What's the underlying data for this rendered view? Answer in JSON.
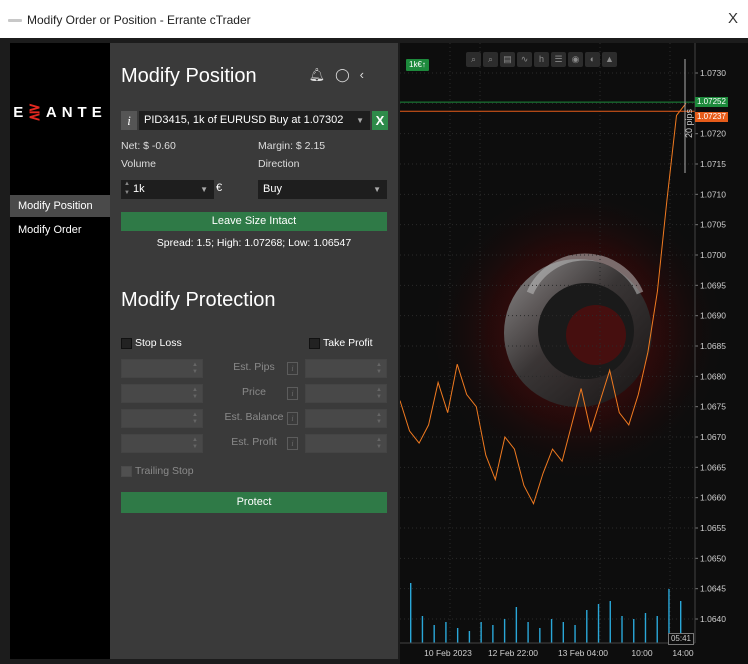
{
  "window": {
    "title": "Modify Order or Position - Errante cTrader",
    "close_glyph": "X"
  },
  "sidebar": {
    "logo_left": "E",
    "logo_right": "ANTE",
    "items": [
      {
        "label": "Modify Position",
        "active": true
      },
      {
        "label": "Modify Order",
        "active": false
      }
    ]
  },
  "modify_position": {
    "title": "Modify Position",
    "info_glyph": "i",
    "position_select": "PID3415, 1k of EURUSD Buy at 1.07302",
    "close_position_glyph": "X",
    "net": "Net: $ -0.60",
    "margin": "Margin: $ 2.15",
    "volume_label": "Volume",
    "direction_label": "Direction",
    "volume_value": "1k",
    "currency": "€",
    "direction_value": "Buy",
    "leave_size_button": "Leave Size Intact",
    "spread_line": "Spread: 1.5; High: 1.07268; Low: 1.06547"
  },
  "modify_protection": {
    "title": "Modify Protection",
    "stop_loss_label": "Stop Loss",
    "take_profit_label": "Take Profit",
    "rows": [
      "Est. Pips",
      "Price",
      "Est. Balance",
      "Est. Profit"
    ],
    "trailing_stop_label": "Trailing Stop",
    "protect_button": "Protect"
  },
  "chart_panel": {
    "badge": "1k€",
    "pips_label": "20 pips",
    "current_price": "1.07252",
    "entry_price": "1.07237",
    "cursor_time": "05:41",
    "colors": {
      "price_line": "#f07a20",
      "volume": "#2aa7d8",
      "bid": "#1d8a3c",
      "entry": "#e65c1a"
    }
  },
  "chart_data": {
    "type": "line",
    "y_tick_labels": [
      "1.0730",
      "1.0725",
      "1.0720",
      "1.0715",
      "1.0710",
      "1.0705",
      "1.0700",
      "1.0695",
      "1.0690",
      "1.0685",
      "1.0680",
      "1.0675",
      "1.0670",
      "1.0665",
      "1.0660",
      "1.0655",
      "1.0650",
      "1.0645",
      "1.0640"
    ],
    "x_tick_labels": [
      "10 Feb 2023",
      "12 Feb 22:00",
      "13 Feb 04:00",
      "10:00",
      "14:00"
    ],
    "ylim": [
      1.0636,
      1.0732
    ],
    "y_prices": [
      1.0676,
      1.0671,
      1.0669,
      1.0672,
      1.0679,
      1.0674,
      1.0682,
      1.0677,
      1.0675,
      1.0667,
      1.0663,
      1.067,
      1.0668,
      1.0662,
      1.0659,
      1.0664,
      1.0668,
      1.0666,
      1.0672,
      1.0678,
      1.0671,
      1.0676,
      1.0681,
      1.0674,
      1.0672,
      1.0677,
      1.0684,
      1.0694,
      1.0709,
      1.0723,
      1.0725
    ],
    "volumes": [
      40,
      18,
      12,
      14,
      10,
      8,
      14,
      12,
      16,
      24,
      14,
      10,
      16,
      14,
      12,
      22,
      26,
      28,
      18,
      16,
      20,
      18,
      36,
      28
    ],
    "current_price": 1.07252,
    "entry_price": 1.07237
  }
}
